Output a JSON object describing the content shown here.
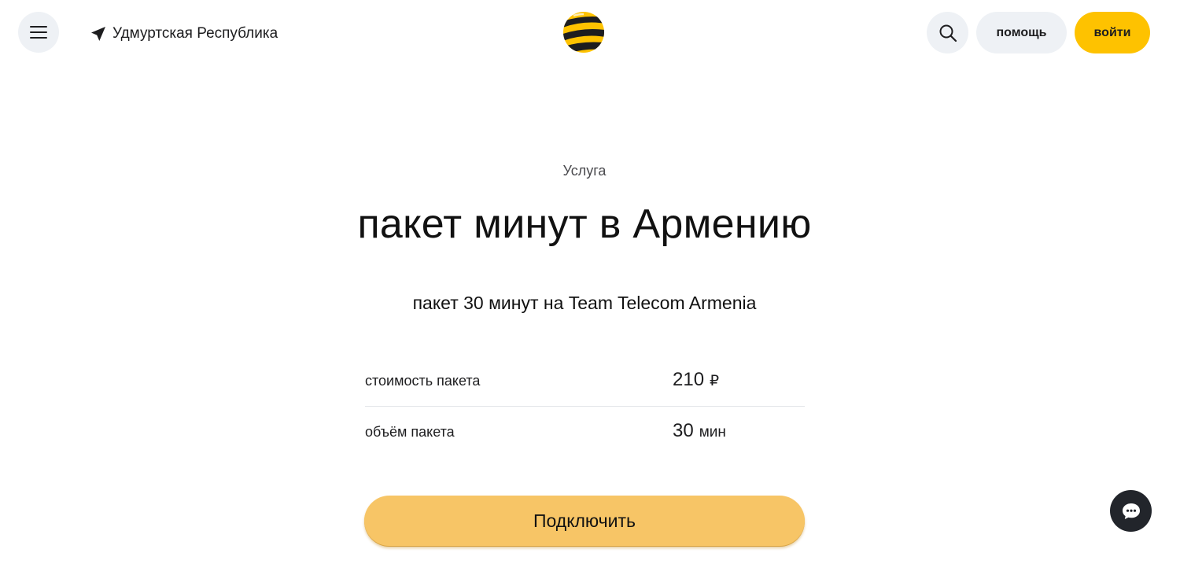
{
  "header": {
    "menu_icon": "hamburger-icon",
    "region_icon": "location-arrow-icon",
    "region": "Удмуртская Республика",
    "logo": "beeline-logo",
    "search_icon": "search-icon",
    "help_label": "помощь",
    "login_label": "войти"
  },
  "main": {
    "eyebrow": "Услуга",
    "title": "пакет минут в Армению",
    "subtitle": "пакет 30 минут на Team Telecom Armenia",
    "params": [
      {
        "label": "стоимость пакета",
        "value": "210",
        "unit": "₽"
      },
      {
        "label": "объём пакета",
        "value": "30",
        "unit": "мин"
      }
    ],
    "connect_label": "Подключить"
  },
  "chat": {
    "icon": "chat-bubble-icon"
  },
  "colors": {
    "brand_yellow": "#fec200",
    "button_yellow": "#f7c566",
    "neutral_button": "#eef1f5",
    "dark": "#22252b"
  }
}
